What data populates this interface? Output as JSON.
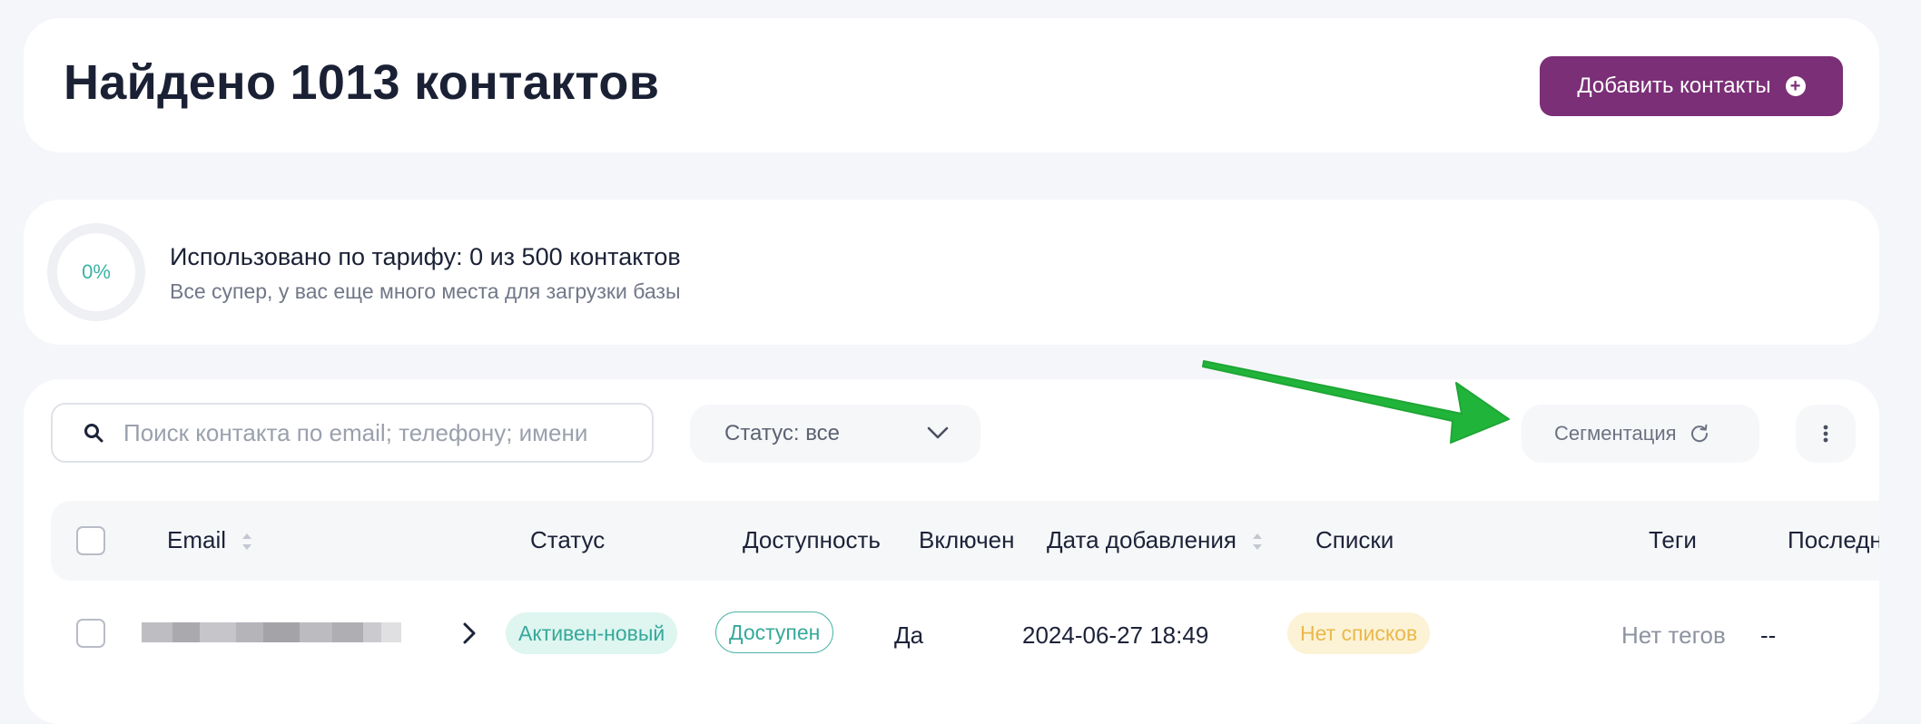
{
  "header": {
    "title": "Найдено 1013 контактов",
    "add_button_label": "Добавить контакты"
  },
  "usage": {
    "percent_label": "0%",
    "percent_value": 0,
    "title": "Использовано по тарифу: 0 из 500 контактов",
    "subtitle": "Все супер, у вас еще много места для загрузки базы"
  },
  "toolbar": {
    "search_placeholder": "Поиск контакта по email; телефону; имени",
    "search_value": "",
    "status_filter_label": "Статус: все",
    "segmentation_label": "Сегментация"
  },
  "table": {
    "columns": [
      "Email",
      "Статус",
      "Доступность",
      "Включен",
      "Дата добавления",
      "Списки",
      "Теги",
      "Последн"
    ],
    "rows": [
      {
        "email": "",
        "status": "Активен-новый",
        "availability": "Доступен",
        "enabled": "Да",
        "date_added": "2024-06-27 18:49",
        "lists": "Нет списков",
        "tags": "Нет тегов",
        "last": "--"
      }
    ]
  },
  "colors": {
    "primary": "#7b2f77",
    "teal": "#36a99a",
    "warning": "#eab84a",
    "annotation_arrow": "#21b43a"
  },
  "icons": [
    "plus-circle-icon",
    "search-icon",
    "chevron-down-icon",
    "refresh-icon",
    "more-vertical-icon",
    "sort-icon",
    "chevron-right-icon"
  ]
}
